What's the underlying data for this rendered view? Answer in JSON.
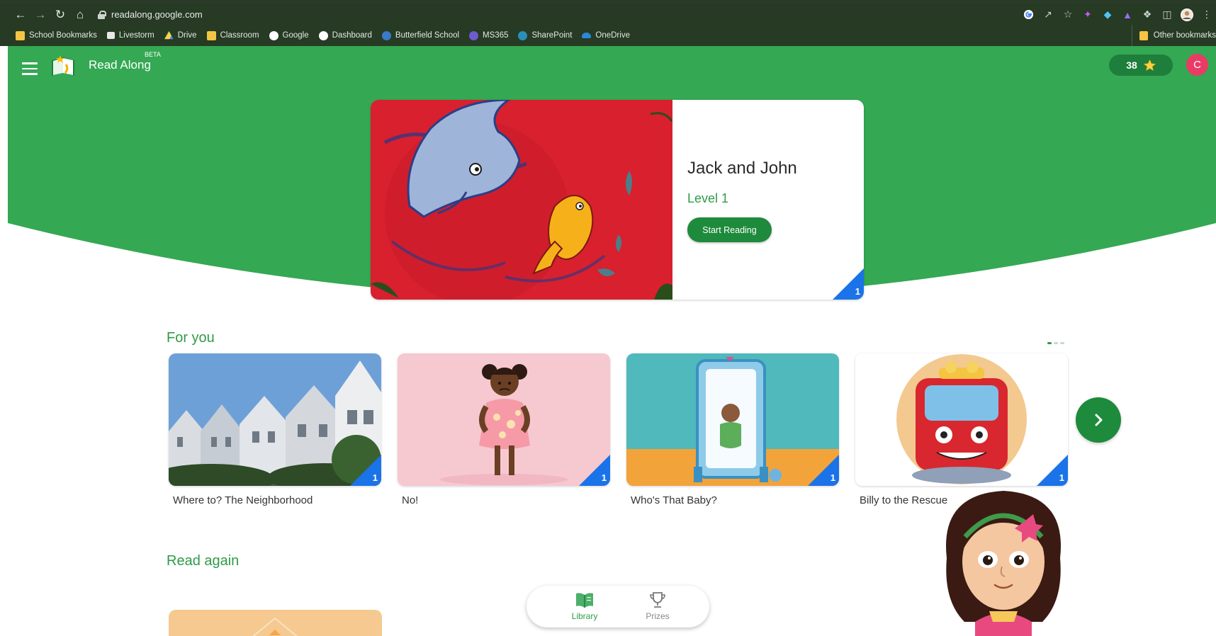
{
  "browser": {
    "url": "readalong.google.com",
    "bookmarks": [
      {
        "label": "School Bookmarks",
        "color": "#f4c443"
      },
      {
        "label": "Livestorm",
        "color": "#e8e8e8"
      },
      {
        "label": "Drive",
        "color": "#1fa463"
      },
      {
        "label": "Classroom",
        "color": "#f4c443"
      },
      {
        "label": "Google",
        "color": "#ffffff"
      },
      {
        "label": "Dashboard",
        "color": "#ffffff"
      },
      {
        "label": "Butterfield School",
        "color": "#3b79c9"
      },
      {
        "label": "MS365",
        "color": "#6d5bd0"
      },
      {
        "label": "SharePoint",
        "color": "#2a8fb8"
      },
      {
        "label": "OneDrive",
        "color": "#2b88d8"
      }
    ],
    "other_bookmarks": "Other bookmarks"
  },
  "app": {
    "brand": "Read Along",
    "beta": "BETA",
    "stars": "38",
    "avatar_initial": "C",
    "colors": {
      "primary": "#34a853",
      "dark_green": "#1e8a3c",
      "level_corner": "#1a73e8",
      "avatar": "#ea3b66"
    }
  },
  "featured": {
    "title": "Jack and John",
    "level": "Level 1",
    "button": "Start Reading",
    "level_badge": "1"
  },
  "for_you": {
    "title": "For you",
    "books": [
      {
        "title": "Where to? The Neighborhood",
        "level": "1"
      },
      {
        "title": "No!",
        "level": "1"
      },
      {
        "title": "Who's That Baby?",
        "level": "1"
      },
      {
        "title": "Billy to the Rescue",
        "level": "1"
      }
    ]
  },
  "read_again": {
    "title": "Read again"
  },
  "bottom_nav": {
    "tabs": [
      {
        "label": "Library",
        "active": true
      },
      {
        "label": "Prizes",
        "active": false
      }
    ]
  }
}
